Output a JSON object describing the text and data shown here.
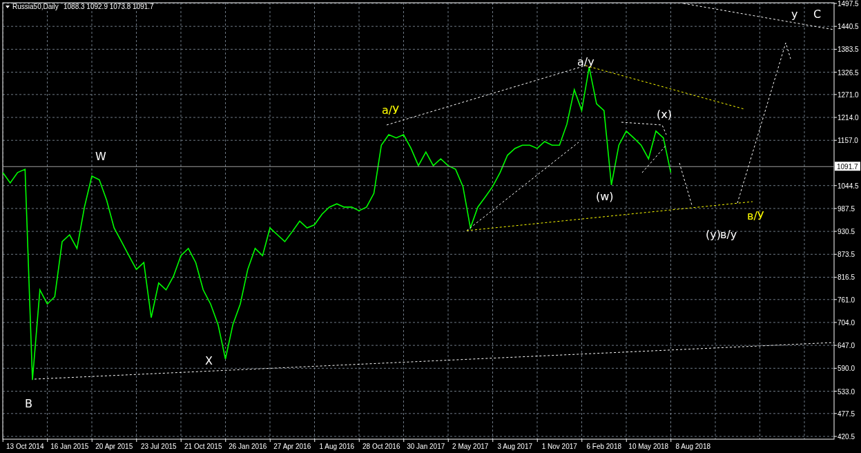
{
  "header": {
    "symbol": "Russia50,Daily",
    "ohlc": "1088.3 1092.9 1073.8 1091.7"
  },
  "price_tag": "1091.7",
  "chart_data": {
    "type": "line",
    "ylim": [
      420.5,
      1497.5
    ],
    "grid": true,
    "categories": [
      null,
      null,
      null,
      "13 Oct 2014",
      null,
      null,
      null,
      null,
      null,
      "16 Jan 2015",
      null,
      null,
      null,
      null,
      null,
      "20 Apr 2015",
      null,
      null,
      null,
      null,
      null,
      "23 Jul 2015",
      null,
      null,
      null,
      null,
      null,
      "21 Oct 2015",
      null,
      null,
      null,
      null,
      null,
      "26 Jan 2016",
      null,
      null,
      null,
      null,
      null,
      "27 Apr 2016",
      null,
      null,
      null,
      null,
      null,
      "1 Aug 2016",
      null,
      null,
      null,
      null,
      null,
      "28 Oct 2016",
      null,
      null,
      null,
      null,
      null,
      "30 Jan 2017",
      null,
      null,
      null,
      null,
      null,
      "2 May 2017",
      null,
      null,
      null,
      null,
      null,
      "3 Aug 2017",
      null,
      null,
      null,
      null,
      null,
      "1 Nov 2017",
      null,
      null,
      null,
      null,
      null,
      "6 Feb 2018",
      null,
      null,
      null,
      null,
      null,
      "10 May 2018",
      null,
      null,
      null,
      null,
      null,
      "8 Aug 2018"
    ],
    "series": [
      {
        "color": "#00ff00",
        "values": [
          1077,
          1051,
          1077,
          1085,
          561,
          785,
          750,
          768,
          905,
          922,
          888,
          991,
          1068,
          1059,
          1008,
          939,
          905,
          870,
          836,
          853,
          716,
          802,
          785,
          819,
          870,
          888,
          853,
          785,
          750,
          699,
          613,
          699,
          750,
          836,
          888,
          870,
          939,
          922,
          905,
          930,
          956,
          939,
          947,
          973,
          991,
          999,
          991,
          991,
          982,
          991,
          1025,
          1145,
          1171,
          1163,
          1171,
          1137,
          1094,
          1128,
          1094,
          1111,
          1094,
          1085,
          1042,
          939,
          991,
          1016,
          1042,
          1077,
          1120,
          1137,
          1145,
          1145,
          1137,
          1154,
          1145,
          1145,
          1197,
          1283,
          1231,
          1339,
          1248,
          1231,
          1046,
          1145,
          1180,
          1163,
          1145,
          1111,
          1180,
          1163,
          1077,
          null,
          null,
          null
        ]
      }
    ],
    "yticks": [
      {
        "value": 1497.5,
        "label": "1497.5"
      },
      {
        "value": 1440.5,
        "label": "1440.5"
      },
      {
        "value": 1383.5,
        "label": "1383.5"
      },
      {
        "value": 1326.5,
        "label": "1326.5"
      },
      {
        "value": 1271,
        "label": "1271.0"
      },
      {
        "value": 1214,
        "label": "1214.0"
      },
      {
        "value": 1157,
        "label": "1157.0"
      },
      {
        "value": 1044.5,
        "label": "1044.5"
      },
      {
        "value": 987.5,
        "label": "987.5"
      },
      {
        "value": 930.5,
        "label": "930.5"
      },
      {
        "value": 873.5,
        "label": "873.5"
      },
      {
        "value": 816.5,
        "label": "816.5"
      },
      {
        "value": 761,
        "label": "761.0"
      },
      {
        "value": 704,
        "label": "704.0"
      },
      {
        "value": 647,
        "label": "647.0"
      },
      {
        "value": 590,
        "label": "590.0"
      },
      {
        "value": 533,
        "label": "533.0"
      },
      {
        "value": 477.5,
        "label": "477.5"
      },
      {
        "value": 420.5,
        "label": "420.5"
      }
    ],
    "annotations": [
      "W",
      "X",
      "B",
      "a/У",
      "a/y",
      "(x)",
      "(w)",
      "(y)",
      "в/у",
      "в/У",
      "y",
      "C"
    ]
  }
}
